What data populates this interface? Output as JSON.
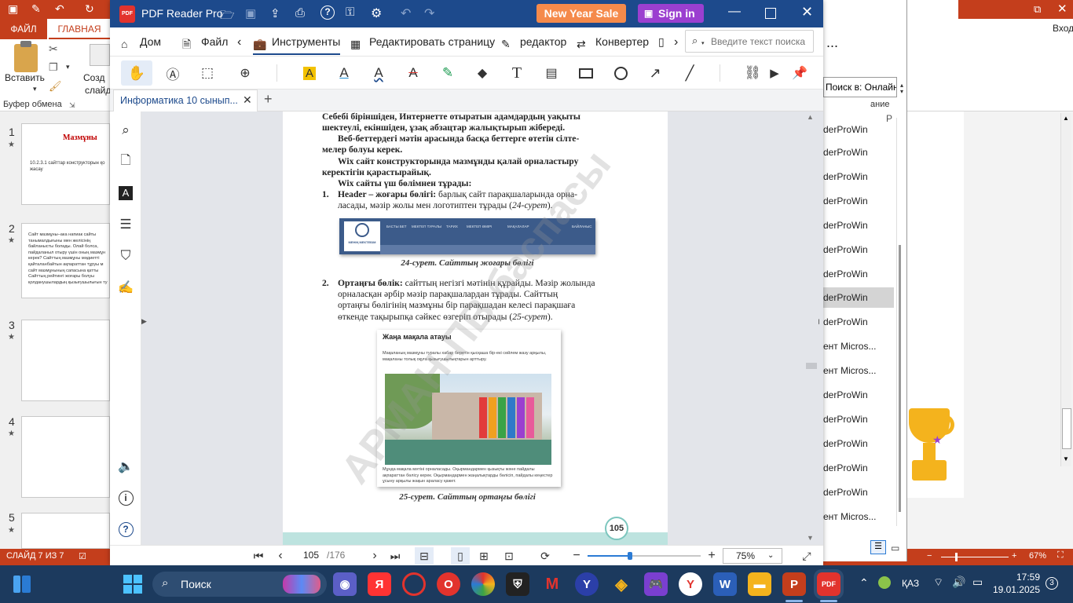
{
  "ppt": {
    "tab_file": "ФАЙЛ",
    "tab_home": "ГЛАВНАЯ",
    "paste_label": "Вставить",
    "create_label_1": "Созд",
    "create_label_2": "слайд",
    "clipboard_label": "Буфер обмена",
    "signin_label": "Вход",
    "dots": "...",
    "search_label": "Поиск в: Онлайн...",
    "hint_label": "ание",
    "status_slide": "СЛАЙД 7 ИЗ 7",
    "status_zoom": "67%",
    "slides": [
      {
        "num": "1",
        "title": "Мазмұны",
        "body": "10.2.3.1 сайттар конструкторын қо жасау"
      },
      {
        "num": "2",
        "body": "Сайт мазмұны–ака напиак сайты танымалдығыны мен желісінің байланысты болады. Олай болса, пайдаланыл отыру үшін оның мазмұн керек? Сайттың мазмұны мәдиетті қайталанбайтын ақпараттан тұруы м сайт мазмұнының сапасына қатты Сайттың рейтингі жоғары болуы қолданушылардың қызығушылығын ту"
      },
      {
        "num": "3"
      },
      {
        "num": "4"
      },
      {
        "num": "5"
      }
    ],
    "dialog_items": [
      "derProWin",
      "derProWin",
      "derProWin",
      "derProWin",
      "derProWin",
      "derProWin",
      "derProWin",
      "derProWin",
      "derProWin",
      "ент Micros...",
      "ент Micros...",
      "derProWin",
      "derProWin",
      "derProWin",
      "derProWin",
      "derProWin",
      "ент Micros..."
    ],
    "dialog_col_p": "Р"
  },
  "pdf": {
    "app_title": "PDF Reader Pro",
    "promo_label": "New Year Sale",
    "signin_label": "Sign in",
    "menu": {
      "home": "Дом",
      "file": "Файл",
      "tools": "Инструменты",
      "edit_page": "Редактировать страницу",
      "editor": "редактор",
      "converter": "Конвертер"
    },
    "search_placeholder": "Введите текст поиска",
    "tab_title": "Информатика 10 сынып...",
    "page_lines": [
      "Себебі біріншіден, Интернетте отыратын адамдардың уақыты",
      "шектеулі, екіншіден, ұзақ абзацтар жалықтырып жібереді.",
      "Веб-беттердегі мәтін арасында басқа беттерге өтетін сілте-",
      "мелер болуы керек.",
      "Wix сайт конструкторында мазмұнды қалай орналастыру",
      "керектігін қарастырайық.",
      "Wix сайты үш бөлімнен тұрады:"
    ],
    "list1_num": "1.",
    "list1_bold": "Header – жоғары бөлігі:",
    "list1_text": " барлық сайт парақшаларында орна-",
    "list1_text2": "ласады, мәзір жолы мен логотиптен тұрады (",
    "list1_ref": "24-сурет",
    "list1_end": ").",
    "header_img_menu": [
      "БАСТЫ БЕТ",
      "МЕКТЕП ТУРАЛЫ",
      "ТАРИХ",
      "МЕКТЕП ӨМІРІ",
      "МАҚАЛАЛАР",
      "БАЙЛАНЫС"
    ],
    "header_img_logo": "МЕНІҢ МЕКТЕБІМ",
    "caption1": "24-сурет. Сайттың жоғары бөлігі",
    "list2_num": "2.",
    "list2_bold": "Ортаңғы бөлік:",
    "list2_lines": [
      " сайттың негізгі мәтінін құрайды. Мәзір жолында",
      "орналасқан әрбір мәзір парақшалардан тұрады. Сайттың",
      "ортаңғы бөлігінің мазмұны бір парақшадан келесі парақшаға",
      "өткенде тақырыпқа сәйкес өзгеріп отырады ("
    ],
    "list2_ref": "25-сурет",
    "list2_end": ").",
    "article_title": "Жаңа мақала атауы",
    "article_lead": "Мақаланың мазмұны туралы хабар беретін қысқаша бір-екі сөйлем жазу арқылы, мақаланы толық оқуға қызығушылықтарын арттыру.",
    "article_body": "Мұнда мақала мәтіні орналасады. Оқырмандармен қызықты және пайдалы ақпараттан бөлісу керек. Оқырмандармен жаңалықтарды бөлісіп, пайдалы кеңестер ұсыну арқылы жақын араласу қажет.",
    "caption2": "25-сурет. Сайттың ортаңғы бөлігі",
    "page_number": "105",
    "watermark": "АРМАН-ПВ баспасы",
    "nav_current": "105",
    "nav_total": "/176",
    "zoom_value": "75%"
  },
  "taskbar": {
    "search_label": "Поиск",
    "lang": "ҚАЗ",
    "time": "17:59",
    "date": "19.01.2025",
    "notif_count": "3"
  },
  "colors": {
    "ppt_red": "#c43e1c",
    "pdf_blue": "#1d4a8c",
    "promo_orange": "#f58a4b",
    "signin_purple": "#9b3fd0",
    "taskbar": "#1c3a5e"
  }
}
